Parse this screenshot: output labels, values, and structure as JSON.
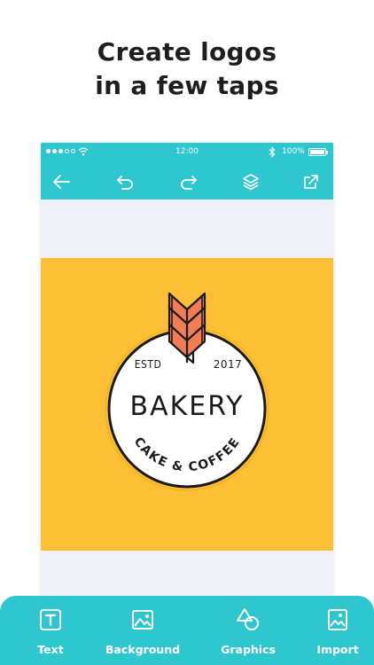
{
  "headline": {
    "line1": "Create logos",
    "line2": "in a few taps"
  },
  "statusbar": {
    "time": "12:00",
    "battery": "100%"
  },
  "toolbar": {
    "icons": [
      "back-arrow-icon",
      "undo-icon",
      "redo-icon",
      "layers-icon",
      "share-icon"
    ]
  },
  "logo": {
    "estd_label": "ESTD",
    "year": "2017",
    "name": "BAKERY",
    "tagline": "CAKE & COFFEE",
    "colors": {
      "background": "#fdbf35",
      "badge": "#ffffff",
      "outline": "#1a1a1a",
      "wheat": "#f27d54",
      "accent_ring": "#f5b21a"
    }
  },
  "bottom_bar": {
    "items": [
      {
        "label": "Text",
        "icon": "text-icon"
      },
      {
        "label": "Background",
        "icon": "image-icon"
      },
      {
        "label": "Graphics",
        "icon": "shapes-icon"
      },
      {
        "label": "Import",
        "icon": "import-image-icon"
      }
    ]
  },
  "colors": {
    "accent": "#2ec7cf",
    "canvas_bg": "#eef0f6",
    "headline": "#1e1e1e"
  }
}
